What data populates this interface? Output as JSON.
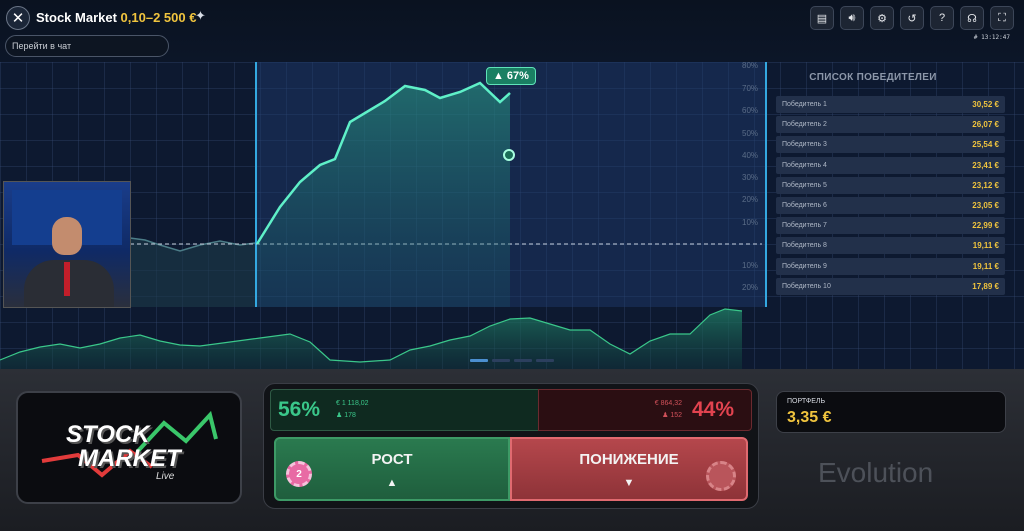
{
  "header": {
    "title": "Stock Market",
    "range": "0,10–2 500 €",
    "chat_placeholder": "Перейти в чат",
    "time": "# 13:12:47",
    "icons": [
      "chat-icon",
      "sound-icon",
      "gear-icon",
      "history-icon",
      "help-icon",
      "headset-icon",
      "fullscreen-icon"
    ]
  },
  "chart": {
    "badge": "67%",
    "axis_labels": [
      "80%",
      "70%",
      "60%",
      "50%",
      "40%",
      "30%",
      "20%",
      "10%",
      "10%",
      "20%"
    ]
  },
  "winners": {
    "title": "СПИСОК ПОБЕДИТЕЛЕИ",
    "items": [
      {
        "name": "Победитель 1",
        "amount": "30,52 €"
      },
      {
        "name": "Победитель 2",
        "amount": "26,07 €"
      },
      {
        "name": "Победитель 3",
        "amount": "25,54 €"
      },
      {
        "name": "Победитель 4",
        "amount": "23,41 €"
      },
      {
        "name": "Победитель 5",
        "amount": "23,12 €"
      },
      {
        "name": "Победитель 6",
        "amount": "23,05 €"
      },
      {
        "name": "Победитель 7",
        "amount": "22,99 €"
      },
      {
        "name": "Победитель 8",
        "amount": "19,11 €"
      },
      {
        "name": "Победитель 9",
        "amount": "19,11 €"
      },
      {
        "name": "Победитель 10",
        "amount": "17,89 €"
      }
    ]
  },
  "bets": {
    "up_pct": "56%",
    "up_amount": "€ 1 118,02",
    "up_players": "178",
    "down_pct": "44%",
    "down_amount": "€ 864,32",
    "down_players": "152",
    "up_label": "РОСТ",
    "down_label": "ПОНИЖЕНИЕ",
    "chip_value": "2"
  },
  "logo": {
    "line1": "STOCK",
    "line2": "MARKET",
    "line3": "Live"
  },
  "portfolio": {
    "label": "ПОРТФЕЛЬ",
    "value": "3,35 €"
  },
  "provider": "Evolution",
  "colors": {
    "accent": "#f0c43e",
    "up": "#3ac78a",
    "down": "#e2434f"
  }
}
